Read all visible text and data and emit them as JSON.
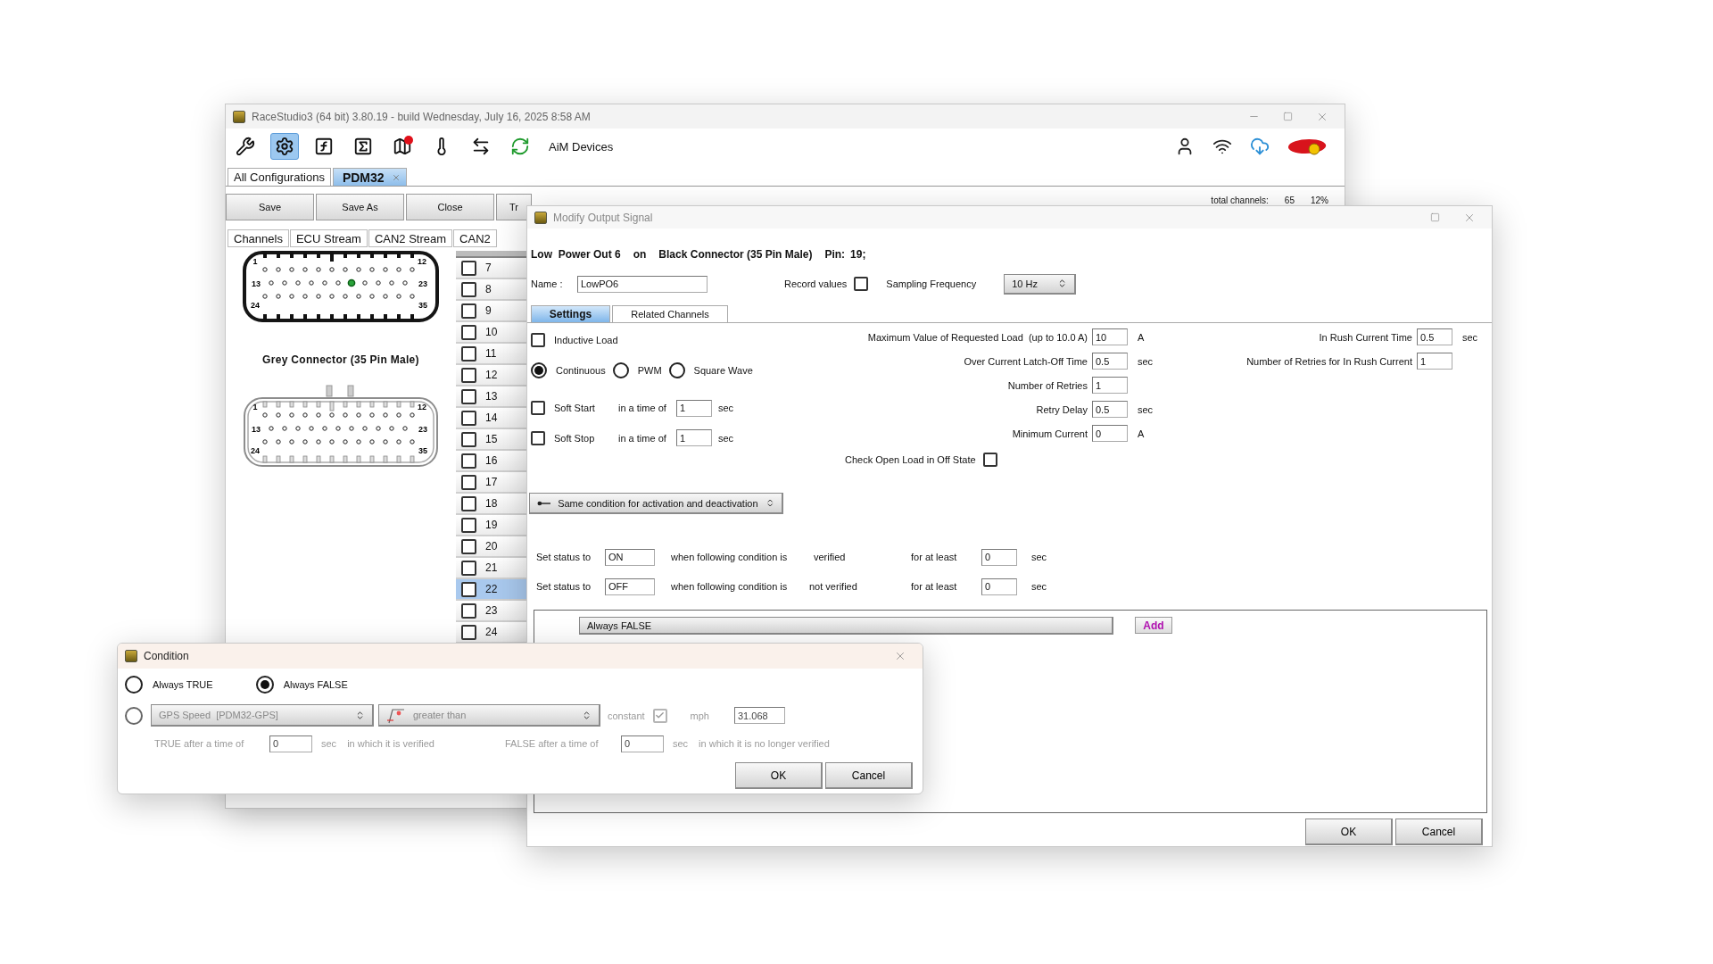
{
  "main_window": {
    "title": "RaceStudio3 (64 bit) 3.80.19 - build Wednesday, July 16, 2025 8:58 AM",
    "tools": [
      {
        "kind": "wrench",
        "selected": false
      },
      {
        "kind": "gear",
        "selected": true
      },
      {
        "kind": "formula",
        "selected": false
      },
      {
        "kind": "sum",
        "selected": false
      },
      {
        "kind": "map",
        "selected": false,
        "alert": true
      },
      {
        "kind": "gauge",
        "selected": false
      },
      {
        "kind": "transfer",
        "selected": false
      },
      {
        "kind": "sync",
        "selected": false
      }
    ],
    "devices_label": "AiM Devices",
    "status_icons": [
      {
        "kind": "user"
      },
      {
        "kind": "wifi"
      },
      {
        "kind": "cloud"
      },
      {
        "kind": "logo"
      }
    ],
    "tabs": [
      {
        "label": "All Configurations",
        "selected": false,
        "closable": false
      },
      {
        "label": "PDM32",
        "selected": true,
        "closable": true
      }
    ],
    "buttons": [
      "Save",
      "Save As",
      "Close",
      "Tr"
    ],
    "total_channels": {
      "label": "total channels:",
      "count": "65",
      "percent": "12%"
    },
    "sub_tabs": [
      "Channels",
      "ECU Stream",
      "CAN2 Stream",
      "CAN2"
    ],
    "connectors": [
      {
        "kind": "black",
        "corner_labels": [
          "1",
          "12",
          "13",
          "23",
          "24",
          "35"
        ],
        "highlighted": true
      },
      {
        "kind": "grey",
        "caption": "Grey Connector (35 Pin Male)",
        "corner_labels": [
          "1",
          "12",
          "13",
          "23",
          "24",
          "35"
        ]
      }
    ],
    "channel_rows": [
      {
        "number": "7",
        "checked": false,
        "selected": false
      },
      {
        "number": "8",
        "checked": false,
        "selected": false
      },
      {
        "number": "9",
        "checked": false,
        "selected": false
      },
      {
        "number": "10",
        "checked": false,
        "selected": false
      },
      {
        "number": "11",
        "checked": false,
        "selected": false
      },
      {
        "number": "12",
        "checked": false,
        "selected": false
      },
      {
        "number": "13",
        "checked": false,
        "selected": false
      },
      {
        "number": "14",
        "checked": false,
        "selected": false
      },
      {
        "number": "15",
        "checked": false,
        "selected": false
      },
      {
        "number": "16",
        "checked": false,
        "selected": false
      },
      {
        "number": "17",
        "checked": false,
        "selected": false
      },
      {
        "number": "18",
        "checked": false,
        "selected": false
      },
      {
        "number": "19",
        "checked": false,
        "selected": false
      },
      {
        "number": "20",
        "checked": false,
        "selected": false
      },
      {
        "number": "21",
        "checked": false,
        "selected": false
      },
      {
        "number": "22",
        "checked": false,
        "selected": true
      },
      {
        "number": "23",
        "checked": false,
        "selected": false
      },
      {
        "number": "24",
        "checked": false,
        "selected": false
      }
    ]
  },
  "modify_dialog": {
    "title": "Modify Output Signal",
    "header": [
      "Low  Power Out 6",
      "on",
      "Black Connector (35 Pin Male)"
    ],
    "pin_label": "Pin:",
    "pin": "19;",
    "name": {
      "label": "Name :",
      "value": "LowPO6"
    },
    "record_values": {
      "label": "Record values",
      "checked": false
    },
    "sampling": {
      "label": "Sampling Frequency",
      "value": "10 Hz"
    },
    "tabs": [
      {
        "label": "Settings",
        "selected": true
      },
      {
        "label": "Related Channels",
        "selected": false
      }
    ],
    "inductive_load": {
      "label": "Inductive Load",
      "checked": false
    },
    "modes": [
      {
        "label": "Continuous",
        "selected": true
      },
      {
        "label": "PWM",
        "selected": false
      },
      {
        "label": "Square Wave",
        "selected": false
      }
    ],
    "soft": [
      {
        "label": "Soft Start",
        "checked": false,
        "time_label": "in a time of",
        "value": "1",
        "unit": "sec"
      },
      {
        "label": "Soft Stop",
        "checked": false,
        "time_label": "in a time of",
        "value": "1",
        "unit": "sec"
      }
    ],
    "load_fields": [
      {
        "label": "Maximum Value of Requested Load  (up to 10.0 A)",
        "value": "10",
        "unit": "A"
      },
      {
        "label": "Over Current Latch-Off Time",
        "value": "0.5",
        "unit": "sec"
      },
      {
        "label": "Number of Retries",
        "value": "1"
      },
      {
        "label": "Retry Delay",
        "value": "0.5",
        "unit": "sec"
      },
      {
        "label": "Minimum Current",
        "value": "0",
        "unit": "A"
      }
    ],
    "check_open_load": {
      "label": "Check Open Load in Off State",
      "checked": false
    },
    "inrush_fields": [
      {
        "label": "In Rush Current Time",
        "value": "0.5",
        "unit": "sec"
      },
      {
        "label": "Number of Retries for In Rush Current",
        "value": "1"
      }
    ],
    "condition_mode": "Same condition for activation and deactivation",
    "status_rows": [
      {
        "label": "Set status to",
        "value": "ON",
        "when": "when following condition is",
        "state": "verified",
        "for_label": "for at least",
        "time": "0",
        "unit": "sec"
      },
      {
        "label": "Set status to",
        "value": "OFF",
        "when": "when following condition is",
        "state": "not verified",
        "for_label": "for at least",
        "time": "0",
        "unit": "sec"
      }
    ],
    "conditions": [
      "Always FALSE"
    ],
    "add_button": "Add",
    "buttons": [
      "OK",
      "Cancel"
    ]
  },
  "condition_dialog": {
    "title": "Condition",
    "options": [
      {
        "kind": "fixed",
        "label": "Always TRUE",
        "selected": false
      },
      {
        "kind": "fixed",
        "label": "Always FALSE",
        "selected": true
      },
      {
        "kind": "compare",
        "selected": false,
        "disabled": true,
        "channel": "GPS Speed  [PDM32-GPS]",
        "operator": "greater than",
        "constant_label": "constant",
        "constant_checked": true,
        "unit": "mph",
        "value": "31.068"
      }
    ],
    "timing": [
      {
        "prefix": "TRUE after a time of",
        "value": "0",
        "unit": "sec",
        "suffix": "in which it is verified"
      },
      {
        "prefix": "FALSE after a time of",
        "value": "0",
        "unit": "sec",
        "suffix": "in which it is no longer verified"
      }
    ],
    "buttons": [
      "OK",
      "Cancel"
    ]
  }
}
